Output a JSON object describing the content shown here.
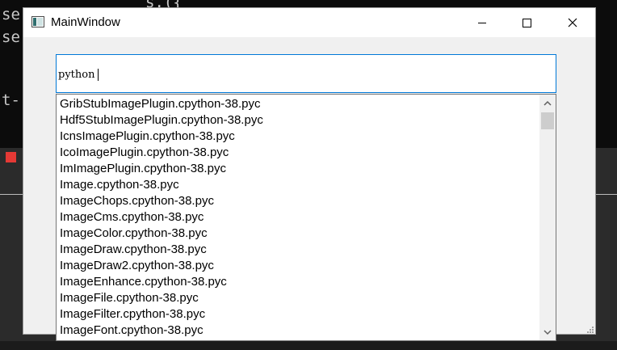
{
  "background": {
    "terminal_lines": [
      "se",
      "se",
      "",
      "",
      "t-"
    ],
    "top_fragment": "s.({",
    "accent_red": "#e53935"
  },
  "window": {
    "title": "MainWindow",
    "icon": "app-window-icon",
    "controls": {
      "minimize": "minimize-icon",
      "maximize": "maximize-icon",
      "close": "close-icon"
    }
  },
  "search": {
    "value": "python"
  },
  "completer": {
    "items": [
      "GribStubImagePlugin.cpython-38.pyc",
      "Hdf5StubImagePlugin.cpython-38.pyc",
      "IcnsImagePlugin.cpython-38.pyc",
      "IcoImagePlugin.cpython-38.pyc",
      "ImImagePlugin.cpython-38.pyc",
      "Image.cpython-38.pyc",
      "ImageChops.cpython-38.pyc",
      "ImageCms.cpython-38.pyc",
      "ImageColor.cpython-38.pyc",
      "ImageDraw.cpython-38.pyc",
      "ImageDraw2.cpython-38.pyc",
      "ImageEnhance.cpython-38.pyc",
      "ImageFile.cpython-38.pyc",
      "ImageFilter.cpython-38.pyc",
      "ImageFont.cpython-38.pyc"
    ],
    "scrollbar": {
      "up": "chevron-up-icon",
      "down": "chevron-down-icon"
    }
  },
  "colors": {
    "focus_border": "#0078d7",
    "window_bg": "#f0f0f0"
  }
}
